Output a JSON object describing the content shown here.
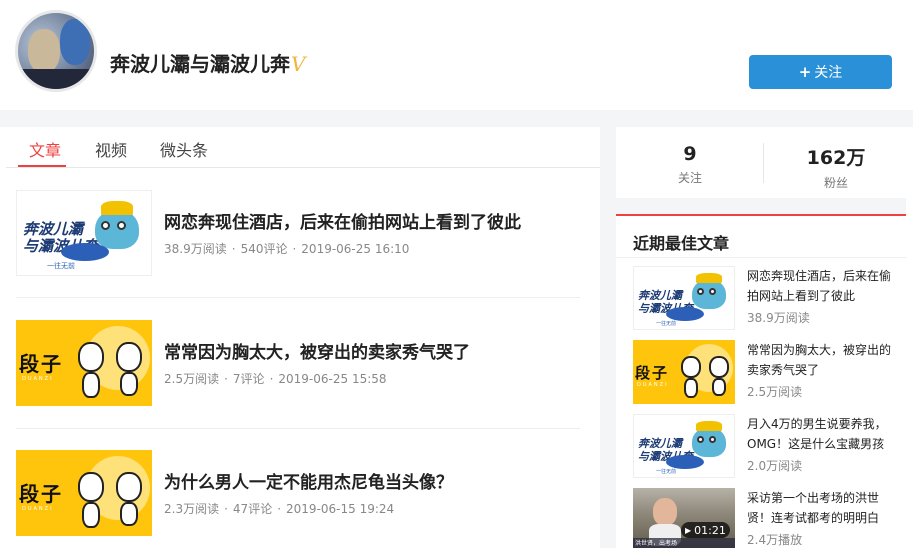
{
  "profile": {
    "name": "奔波儿灞与灞波儿奔",
    "verified_mark": "V",
    "follow_plus": "+",
    "follow_label": "关注"
  },
  "tabs": [
    "文章",
    "视频",
    "微头条"
  ],
  "active_tab": "文章",
  "articles": [
    {
      "title": "网恋奔现住酒店，后来在偷拍网站上看到了彼此",
      "reads": "38.9万阅读",
      "comments": "540评论",
      "date": "2019-06-25 16:10",
      "thumb": "logo"
    },
    {
      "title": "常常因为胸太大，被穿出的卖家秀气哭了",
      "reads": "2.5万阅读",
      "comments": "7评论",
      "date": "2019-06-25 15:58",
      "thumb": "duanzi"
    },
    {
      "title": "为什么男人一定不能用杰尼龟当头像？",
      "reads": "2.3万阅读",
      "comments": "47评论",
      "date": "2019-06-15 19:24",
      "thumb": "duanzi"
    }
  ],
  "stats": {
    "following_count": "9",
    "following_label": "关注",
    "fans_count": "162万",
    "fans_label": "粉丝"
  },
  "best_articles": {
    "heading": "近期最佳文章",
    "items": [
      {
        "title": "网恋奔现住酒店，后来在偷拍网站上看到了彼此",
        "meta": "38.9万阅读",
        "thumb": "logo"
      },
      {
        "title": "常常因为胸太大，被穿出的卖家秀气哭了",
        "meta": "2.5万阅读",
        "thumb": "duanzi"
      },
      {
        "title": "月入4万的男生说要养我，OMG！这是什么宝藏男孩",
        "meta": "2.0万阅读",
        "thumb": "logo"
      },
      {
        "title": "采访第一个出考场的洪世贤！连考试都考的明明白",
        "meta": "2.4万播放",
        "thumb": "video",
        "duration": "01:21"
      }
    ]
  },
  "thumbs": {
    "logo_line1": "奔波儿灞",
    "logo_line2": "与灞波儿奔",
    "logo_slogan": "一往无前",
    "duanzi_text": "段子",
    "duanzi_sub": "DUANZI",
    "video_caption": "洪世贤，出考场"
  },
  "colors": {
    "accent_red": "#f04142",
    "follow_blue": "#2a90d7",
    "duanzi_yellow": "#ffc50d",
    "verified_gold": "#f4b43b"
  }
}
